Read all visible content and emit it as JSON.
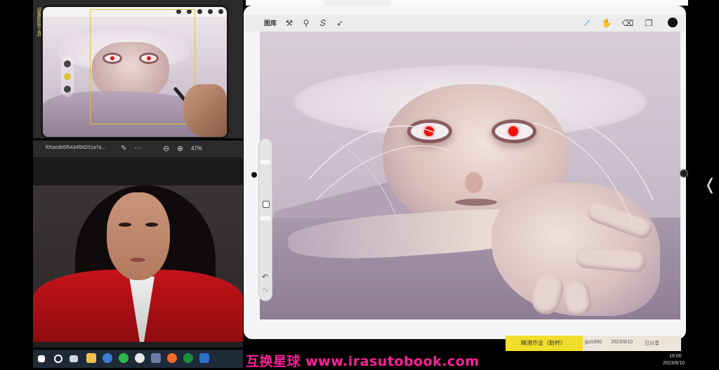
{
  "camera_view": {
    "left_label": "设置图层工具"
  },
  "image_viewer": {
    "filename": "f05ac8b5f5434f9d251a7a...",
    "zoom_level": "47%"
  },
  "procreate": {
    "gallery_label": "图库",
    "tools": {
      "actions": "wrench-icon",
      "adjustments": "wand-icon",
      "selection": "selection-s-icon",
      "transform": "arrow-cursor-icon",
      "brush": "brush-icon",
      "smudge": "smudge-icon",
      "eraser": "eraser-icon",
      "layers": "layers-icon"
    },
    "active_tool_color": "#1a6fd6",
    "current_color": "#111111",
    "eye_color": "#e9120f"
  },
  "document_behind": {
    "row_cells": [
      "精湛作业（胎杯）",
      "jpzs890",
      "2023/9/10",
      "已分享"
    ]
  },
  "watermark": "互换星球 www.irasutobook.com",
  "system_clock": {
    "time": "19:00",
    "date": "2023/6/10"
  }
}
